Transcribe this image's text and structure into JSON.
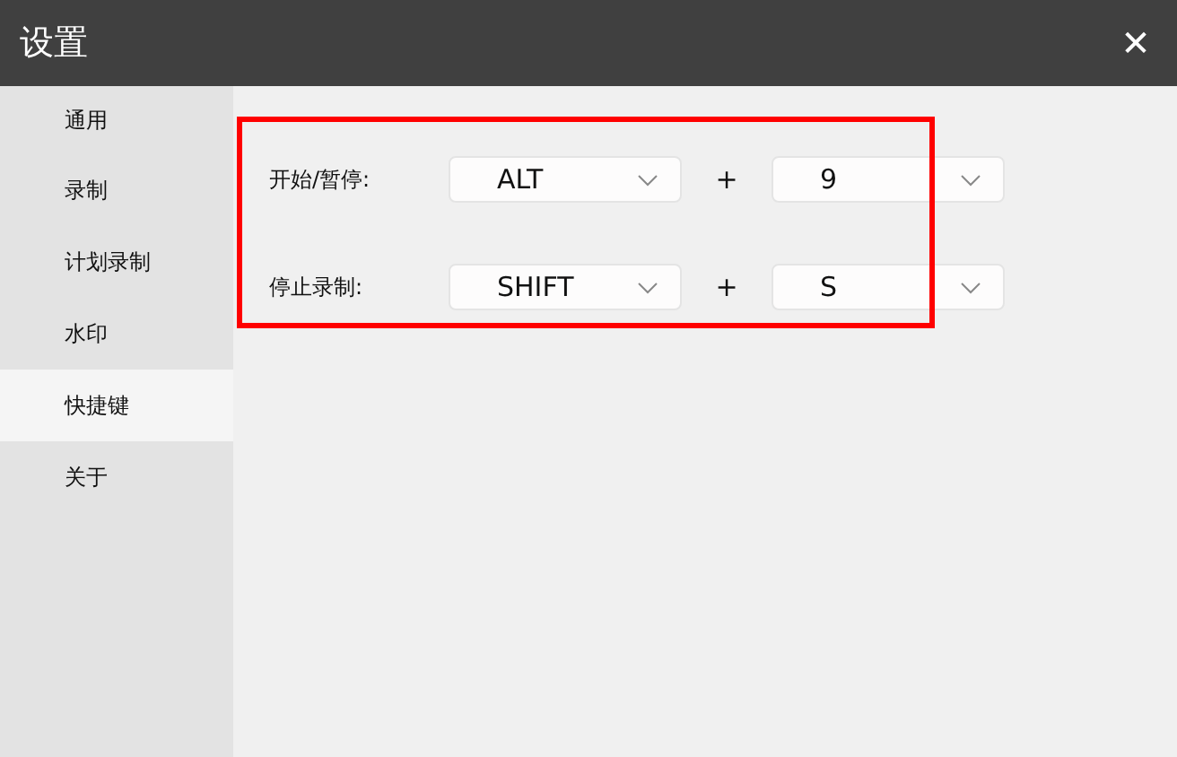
{
  "window": {
    "title": "设置",
    "close": "✕"
  },
  "sidebar": {
    "items": [
      {
        "label": "通用",
        "selected": false
      },
      {
        "label": "录制",
        "selected": false
      },
      {
        "label": "计划录制",
        "selected": false
      },
      {
        "label": "水印",
        "selected": false
      },
      {
        "label": "快捷键",
        "selected": true
      },
      {
        "label": "关于",
        "selected": false
      }
    ]
  },
  "shortcuts": [
    {
      "label": "开始/暂停:",
      "modifier": "ALT",
      "plus": "+",
      "key": "9"
    },
    {
      "label": "停止录制:",
      "modifier": "SHIFT",
      "plus": "+",
      "key": "S"
    }
  ],
  "highlight": {
    "shown": true
  }
}
